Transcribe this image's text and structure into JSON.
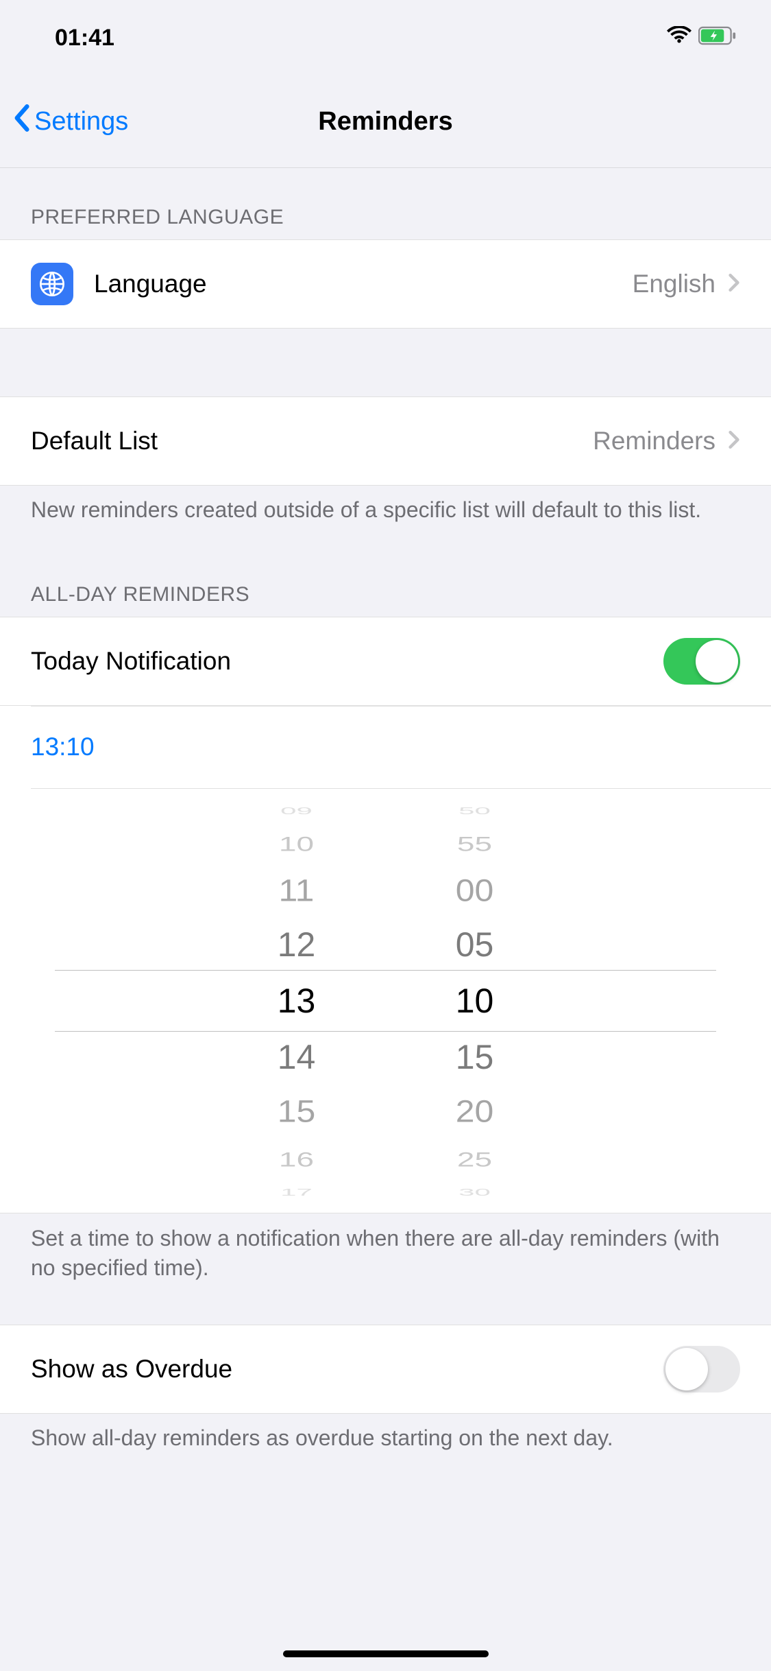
{
  "status_bar": {
    "time": "01:41"
  },
  "nav": {
    "back": "Settings",
    "title": "Reminders"
  },
  "sections": {
    "preferred_language": {
      "header": "PREFERRED LANGUAGE",
      "language_label": "Language",
      "language_value": "English"
    },
    "default_list": {
      "label": "Default List",
      "value": "Reminders",
      "footer": "New reminders created outside of a specific list will default to this list."
    },
    "all_day": {
      "header": "ALL-DAY REMINDERS",
      "today_label": "Today Notification",
      "today_on": true,
      "time_display": "13:10",
      "picker": {
        "hours": [
          "09",
          "10",
          "11",
          "12",
          "13",
          "14",
          "15",
          "16",
          "17"
        ],
        "minutes": [
          "50",
          "55",
          "00",
          "05",
          "10",
          "15",
          "20",
          "25",
          "30"
        ],
        "selected_hour": "13",
        "selected_minute": "10"
      },
      "footer": "Set a time to show a notification when there are all-day reminders (with no specified time)."
    },
    "overdue": {
      "label": "Show as Overdue",
      "on": false,
      "footer": "Show all-day reminders as overdue starting on the next day."
    }
  }
}
